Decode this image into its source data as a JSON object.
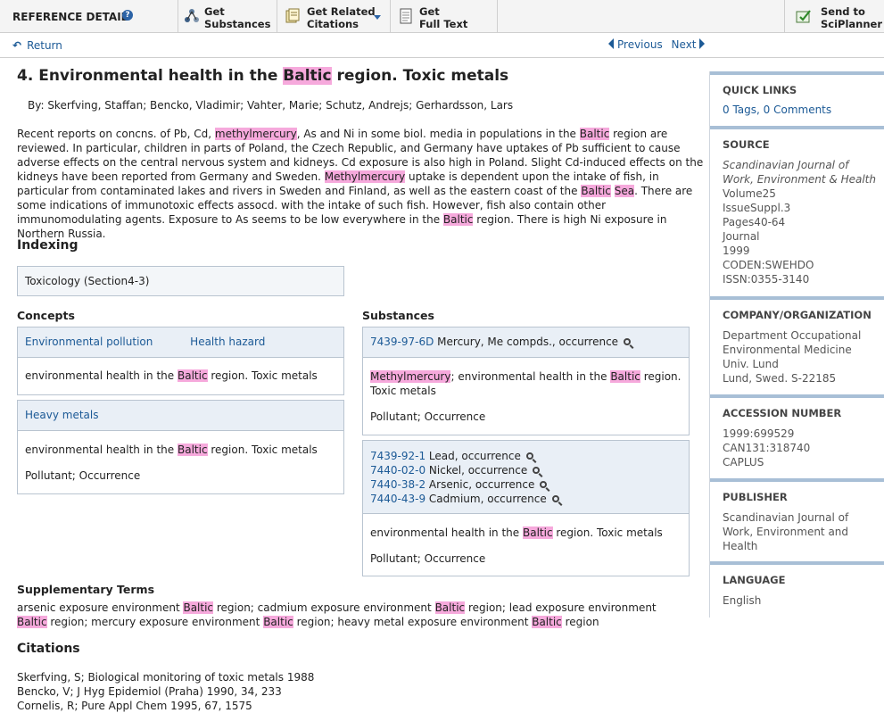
{
  "toolbar": {
    "title": "REFERENCE DETAIL",
    "buttons": [
      {
        "line1": "Get",
        "line2": "Substances"
      },
      {
        "line1": "Get Related",
        "line2": "Citations"
      },
      {
        "line1": "Get",
        "line2": "Full Text"
      },
      {
        "line1": "Send to",
        "line2": "SciPlanner"
      }
    ]
  },
  "nav": {
    "return": "Return",
    "previous": "Previous",
    "next": "Next"
  },
  "record": {
    "title_pre": "4.  Environmental health in the ",
    "title_hl": "Baltic",
    "title_post": " region. Toxic metals",
    "authors": "By: Skerfving, Staffan; Bencko, Vladimir; Vahter, Marie; Schutz, Andrejs; Gerhardsson, Lars",
    "abstract": [
      {
        "t": "Recent reports on concns. of Pb, Cd, "
      },
      {
        "t": "methylmercury",
        "h": true
      },
      {
        "t": ", As and Ni in some biol. media in populations in the "
      },
      {
        "t": "Baltic",
        "h": true
      },
      {
        "t": " region are reviewed.  In particular, children in parts of Poland, the Czech Republic, and Germany have uptakes of Pb sufficient to cause adverse effects on the central nervous system and kidneys.  Cd exposure is also high in Poland.  Slight Cd-induced effects on the kidneys have been reported from Germany and Sweden.  "
      },
      {
        "t": "Methylmercury",
        "h": true
      },
      {
        "t": " uptake is dependent upon the intake of fish, in particular from contaminated lakes and rivers in Sweden and Finland, as well as the eastern coast of the "
      },
      {
        "t": "Baltic",
        "h": true
      },
      {
        "t": " "
      },
      {
        "t": "Sea",
        "h": true
      },
      {
        "t": ".  There are some indications of immunotoxic effects assocd. with the intake of such fish.  However, fish also contain other immunomodulating agents.  Exposure to As seems to be low everywhere in the "
      },
      {
        "t": "Baltic",
        "h": true
      },
      {
        "t": " region.  There is high Ni exposure in Northern Russia."
      }
    ]
  },
  "indexing": {
    "heading": "Indexing",
    "section": "Toxicology (Section4-3)",
    "concepts_heading": "Concepts",
    "substances_heading": "Substances",
    "concept_box1": {
      "links": [
        "Environmental pollution",
        "Health hazard"
      ],
      "desc_pre": "environmental health in the ",
      "desc_hl": "Baltic",
      "desc_post": " region. Toxic metals"
    },
    "concept_box2": {
      "link": "Heavy metals",
      "desc_pre": "environmental health in the ",
      "desc_hl": "Baltic",
      "desc_post": " region. Toxic metals",
      "roles": "Pollutant; Occurrence"
    },
    "substance_box1": {
      "cas": "7439-97-6D",
      "name": " Mercury, Me compds., occurrence",
      "desc_hl1": "Methylmercury",
      "desc_mid": "; environmental health in the ",
      "desc_hl2": "Baltic",
      "desc_post": " region.",
      "desc_line2": "Toxic metals",
      "roles": "Pollutant; Occurrence"
    },
    "substance_box2": {
      "items": [
        {
          "cas": "7439-92-1",
          "name": " Lead, occurrence"
        },
        {
          "cas": "7440-02-0",
          "name": " Nickel, occurrence"
        },
        {
          "cas": "7440-38-2",
          "name": " Arsenic, occurrence"
        },
        {
          "cas": "7440-43-9",
          "name": " Cadmium, occurrence"
        }
      ],
      "desc_pre": "environmental health in the ",
      "desc_hl": "Baltic",
      "desc_post": " region. Toxic metals",
      "roles": "Pollutant; Occurrence"
    }
  },
  "supplementary": {
    "heading": "Supplementary Terms",
    "parts": [
      {
        "t": "arsenic exposure environment "
      },
      {
        "t": "Baltic",
        "h": true
      },
      {
        "t": " region; cadmium exposure environment "
      },
      {
        "t": "Baltic",
        "h": true
      },
      {
        "t": " region; lead exposure environment "
      },
      {
        "t": "Baltic",
        "h": true
      },
      {
        "t": " region; mercury exposure environment "
      },
      {
        "t": "Baltic",
        "h": true
      },
      {
        "t": " region; heavy metal exposure environment "
      },
      {
        "t": "Baltic",
        "h": true
      },
      {
        "t": " region"
      }
    ]
  },
  "citations": {
    "heading": "Citations",
    "items": [
      "Skerfving, S; Biological monitoring of toxic metals 1988",
      "Bencko, V; J Hyg Epidemiol (Praha) 1990, 34, 233",
      "Cornelis, R; Pure Appl Chem 1995, 67, 1575"
    ]
  },
  "sidebar": {
    "quick_links": {
      "heading": "QUICK LINKS",
      "link": "0 Tags, 0 Comments"
    },
    "source": {
      "heading": "SOURCE",
      "journal_line1": "Scandinavian Journal of",
      "journal_line2": "Work, Environment & Health",
      "lines": [
        "Volume25",
        "IssueSuppl.3",
        "Pages40-64",
        "Journal",
        "1999",
        "CODEN:SWEHDO",
        "ISSN:0355-3140"
      ]
    },
    "company": {
      "heading": "COMPANY/ORGANIZATION",
      "lines": [
        "Department Occupational",
        "Environmental Medicine",
        "Univ. Lund",
        "Lund, Swed.  S-22185"
      ]
    },
    "accession": {
      "heading": "ACCESSION NUMBER",
      "lines": [
        "1999:699529",
        "CAN131:318740",
        "CAPLUS"
      ]
    },
    "publisher": {
      "heading": "PUBLISHER",
      "lines": [
        "Scandinavian Journal of",
        "Work, Environment and",
        "Health"
      ]
    },
    "language": {
      "heading": "LANGUAGE",
      "value": "English"
    }
  }
}
